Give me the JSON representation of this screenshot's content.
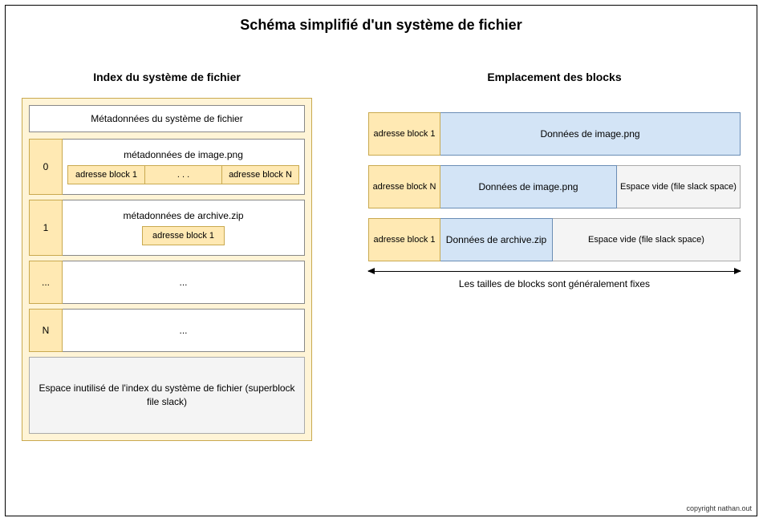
{
  "title": "Schéma simplifié d'un système de fichier",
  "left": {
    "heading": "Index du système de fichier",
    "fs_metadata": "Métadonnées du système de fichier",
    "rows": [
      {
        "idx": "0",
        "meta": "métadonnées de image.png",
        "addrs": [
          "adresse block 1",
          ". . .",
          "adresse block N"
        ]
      },
      {
        "idx": "1",
        "meta": "métadonnées de archive.zip",
        "addr_single": "adresse block 1"
      },
      {
        "idx": "...",
        "meta": "..."
      },
      {
        "idx": "N",
        "meta": "..."
      }
    ],
    "slack": "Espace inutilisé de l'index du système de fichier (superblock file slack)"
  },
  "right": {
    "heading": "Emplacement des blocks",
    "blocks": [
      {
        "addr": "adresse block 1",
        "data": "Données de image.png"
      },
      {
        "addr": "adresse block N",
        "data": "Données de image.png",
        "slack": "Espace vide (file slack space)"
      },
      {
        "addr": "adresse block 1",
        "data": "Données de archive.zip",
        "slack": "Espace vide (file slack space)"
      }
    ],
    "arrow_label": "Les tailles de blocks sont généralement fixes"
  },
  "copyright": "copyright nathan.out"
}
